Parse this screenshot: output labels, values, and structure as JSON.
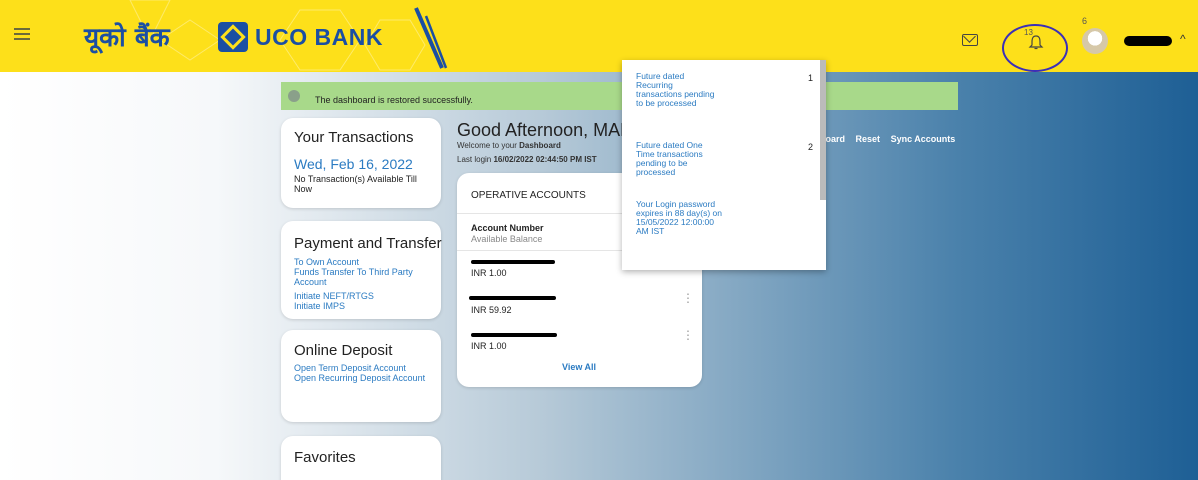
{
  "header": {
    "brand_hindi": "यूको बैंक",
    "brand_english": "UCO BANK",
    "bell_badge": "13",
    "avatar_badge": "6",
    "chevron": "^",
    "colors": {
      "header_bg": "#fde01a",
      "brand_blue": "#1b4fa3"
    }
  },
  "success": {
    "message": "The dashboard is restored successfully."
  },
  "transactions": {
    "title": "Your Transactions",
    "date": "Wed, Feb 16, 2022",
    "note": "No Transaction(s) Available Till Now"
  },
  "payment": {
    "title": "Payment and Transfer",
    "links": [
      "To Own Account",
      "Funds Transfer To Third Party Account",
      "Initiate NEFT/RTGS",
      "Initiate IMPS"
    ]
  },
  "deposit": {
    "title": "Online Deposit",
    "links": [
      "Open Term Deposit Account",
      "Open Recurring Deposit Account"
    ]
  },
  "favorites": {
    "title": "Favorites"
  },
  "greeting": {
    "title": "Good Afternoon, MAN",
    "welcome_prefix": "Welcome to your ",
    "welcome_bold": "Dashboard",
    "last_login_label": "Last login ",
    "last_login_value": "16/02/2022 02:44:50 PM IST"
  },
  "actions": {
    "dashboard": "board",
    "reset": "Reset",
    "sync": "Sync Accounts"
  },
  "operative": {
    "title": "OPERATIVE ACCOUNTS",
    "col_account": "Account Number",
    "col_balance": "Available Balance",
    "balances": [
      "INR 1.00",
      "INR 59.92",
      "INR 1.00"
    ],
    "view_all": "View All"
  },
  "notifications": [
    {
      "text": "Future dated Recurring transactions pending to be processed",
      "count": "1"
    },
    {
      "text": "Future dated One Time transactions pending to be processed",
      "count": "2"
    },
    {
      "text": "Your Login password expires in 88 day(s) on 15/05/2022 12:00:00 AM IST",
      "count": ""
    }
  ]
}
